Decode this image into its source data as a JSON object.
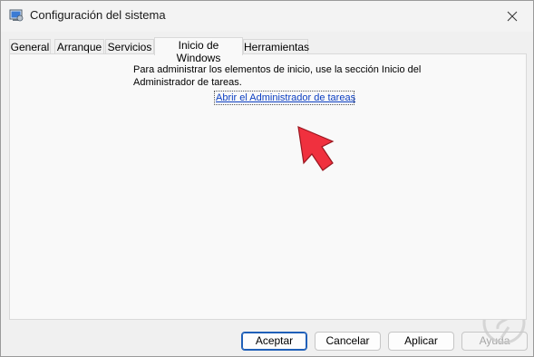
{
  "window": {
    "title": "Configuración del sistema",
    "app_icon": "msconfig-icon",
    "close_icon": "close-icon"
  },
  "tabs": [
    {
      "label": "General",
      "active": false
    },
    {
      "label": "Arranque",
      "active": false
    },
    {
      "label": "Servicios",
      "active": false
    },
    {
      "label": "Inicio de Windows",
      "active": true
    },
    {
      "label": "Herramientas",
      "active": false
    }
  ],
  "panel": {
    "info_text": "Para administrar los elementos de inicio, use la sección Inicio del Administrador de tareas.",
    "link_text": "Abrir el Administrador de tareas",
    "annotation_icon": "red-arrow-icon"
  },
  "buttons": {
    "ok": "Aceptar",
    "cancel": "Cancelar",
    "apply": "Aplicar",
    "help": "Ayuda"
  },
  "colors": {
    "link": "#0c3fc2",
    "arrow": "#f0303e",
    "default_button_border": "#1f5fb8"
  }
}
